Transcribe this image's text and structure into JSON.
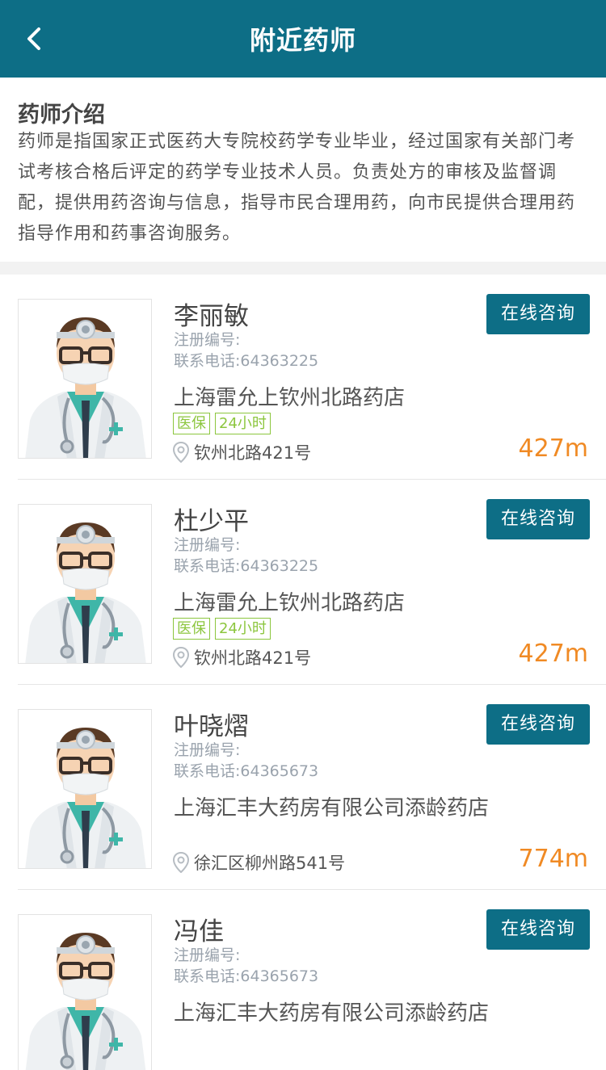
{
  "header": {
    "title": "附近药师"
  },
  "intro": {
    "title": "药师介绍",
    "text": "药师是指国家正式医药大专院校药学专业毕业，经过国家有关部门考试考核合格后评定的药学专业技术人员。负责处方的审核及监督调配，提供用药咨询与信息，指导市民合理用药，向市民提供合理用药指导作用和药事咨询服务。"
  },
  "pharmacists": [
    {
      "name": "李丽敏",
      "reg_label": "注册编号:",
      "phone": "联系电话:64363225",
      "store": "上海雷允上钦州北路药店",
      "tags": [
        "医保",
        "24小时"
      ],
      "address": "钦州北路421号",
      "distance": "427m",
      "button": "在线咨询"
    },
    {
      "name": "杜少平",
      "reg_label": "注册编号:",
      "phone": "联系电话:64363225",
      "store": "上海雷允上钦州北路药店",
      "tags": [
        "医保",
        "24小时"
      ],
      "address": "钦州北路421号",
      "distance": "427m",
      "button": "在线咨询"
    },
    {
      "name": "叶晓熠",
      "reg_label": "注册编号:",
      "phone": "联系电话:64365673",
      "store": "上海汇丰大药房有限公司添龄药店",
      "tags": [],
      "address": "徐汇区柳州路541号",
      "distance": "774m",
      "button": "在线咨询"
    },
    {
      "name": "冯佳",
      "reg_label": "注册编号:",
      "phone": "联系电话:64365673",
      "store": "上海汇丰大药房有限公司添龄药店",
      "tags": [],
      "address": "",
      "distance": "",
      "button": "在线咨询"
    }
  ],
  "colors": {
    "header": "#0d6e86",
    "tag": "#8cc63e",
    "distance": "#f08a24"
  },
  "icons": {
    "back": "chevron-left-icon",
    "location": "location-pin-icon",
    "avatar": "doctor-avatar"
  }
}
